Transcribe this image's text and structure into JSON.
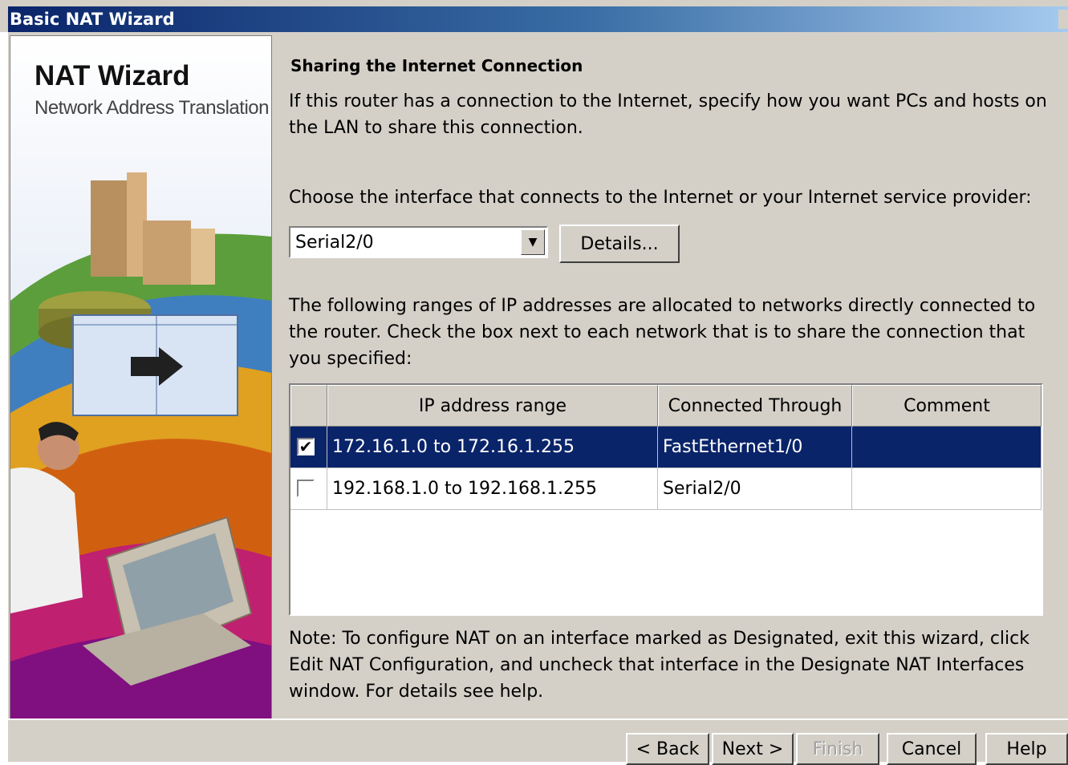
{
  "window": {
    "title": "Basic NAT Wizard"
  },
  "side_panel": {
    "title": "NAT Wizard",
    "subtitle": "Network Address Translation"
  },
  "content": {
    "heading": "Sharing the Internet Connection",
    "intro": "If this router has a connection to the Internet, specify how you want PCs and hosts on the LAN to share this connection.",
    "choose_label": "Choose the interface that connects to the Internet or your Internet service provider:",
    "interface_select": {
      "value": "Serial2/0"
    },
    "details_button": "Details...",
    "ranges_text": "The following ranges of IP addresses are allocated to networks directly connected to the router. Check the box next to each network that is to share the connection that you specified:",
    "table": {
      "headers": [
        "",
        "IP address range",
        "Connected Through",
        "Comment"
      ],
      "rows": [
        {
          "checked": true,
          "range": "172.16.1.0 to 172.16.1.255",
          "through": "FastEthernet1/0",
          "comment": "",
          "selected": true
        },
        {
          "checked": false,
          "range": "192.168.1.0 to 192.168.1.255",
          "through": "Serial2/0",
          "comment": "",
          "selected": false
        }
      ]
    },
    "note": "Note: To configure NAT on an interface marked as Designated, exit this wizard, click Edit NAT Configuration, and uncheck that interface in the Designate NAT Interfaces window. For details see help."
  },
  "buttons": {
    "back": "< Back",
    "next": "Next >",
    "finish": "Finish",
    "cancel": "Cancel",
    "help": "Help"
  },
  "colors": {
    "selection": "#0a246a",
    "dialog_bg": "#d4d0c8"
  }
}
